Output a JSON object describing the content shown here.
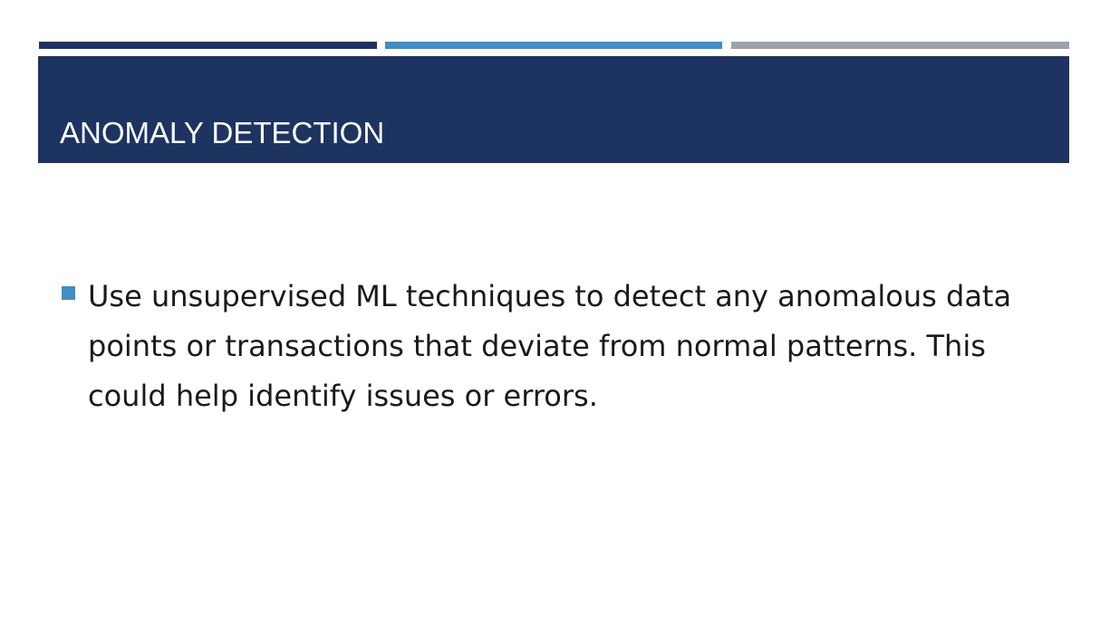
{
  "slide": {
    "title": "ANOMALY DETECTION",
    "bullets": [
      {
        "text": "Use unsupervised ML techniques to detect any anomalous data points or transactions that deviate from normal patterns. This could help identify issues or errors."
      }
    ]
  },
  "colors": {
    "title_band": "#1d3461",
    "accent_dark": "#1d3461",
    "accent_blue": "#3f8ec5",
    "accent_gray": "#9aa3ad",
    "bullet_marker": "#3f8ec5"
  }
}
